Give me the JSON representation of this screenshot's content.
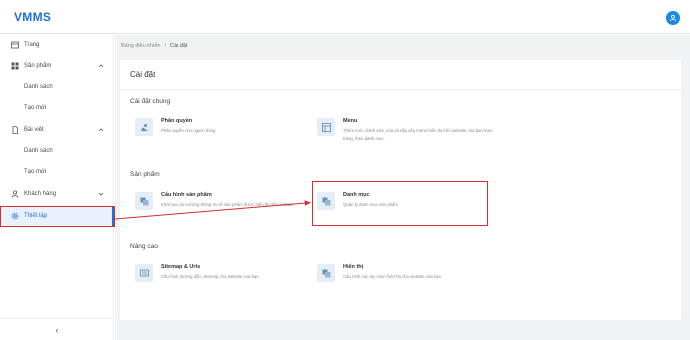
{
  "app": {
    "brand": "VMMS"
  },
  "sidebar": {
    "items": [
      {
        "label": "Trang",
        "icon": "grid-icon"
      },
      {
        "label": "Sản phẩm",
        "icon": "product-icon"
      },
      {
        "label": "Danh sách"
      },
      {
        "label": "Tạo mới"
      },
      {
        "label": "Bài viết",
        "icon": "article-icon"
      },
      {
        "label": "Danh sách"
      },
      {
        "label": "Tạo mới"
      },
      {
        "label": "Khách hàng",
        "icon": "user-icon"
      },
      {
        "label": "Thiết lập",
        "icon": "gear-icon"
      }
    ],
    "collapse_glyph": "‹"
  },
  "breadcrumb": {
    "parent": "Bảng điều khiển",
    "separator": "/",
    "current": "Cài đặt"
  },
  "page": {
    "title": "Cài đặt"
  },
  "sections": [
    {
      "title": "Cài đặt chung",
      "items": [
        {
          "name": "Phân quyền",
          "desc": "Phân quyền cho người dùng",
          "icon": "permission-icon"
        },
        {
          "name": "Menu",
          "desc": "Thêm mới, chỉnh sửa, xóa và sắp xếp menu hiển thị trên website của bạn theo trang, theo danh mục.",
          "icon": "menu-icon"
        }
      ]
    },
    {
      "title": "Sản phẩm",
      "items": [
        {
          "name": "Cấu hình sản phẩm",
          "desc": "Khởi tạo các trường thông tin về sản phẩm được hiển thị trên website",
          "icon": "product-config-icon"
        },
        {
          "name": "Danh mục",
          "desc": "Quản lý danh mục sản phẩm",
          "icon": "category-icon"
        }
      ]
    },
    {
      "title": "Nâng cao",
      "items": [
        {
          "name": "Sitemap & Urls",
          "desc": "Cấu hình đường dẫn, sitemap cho website của bạn.",
          "icon": "sitemap-icon"
        },
        {
          "name": "Hiển thị",
          "desc": "Cấu hình các tùy chọn hiển thị cho website của bạn",
          "icon": "display-icon"
        }
      ]
    }
  ],
  "colors": {
    "brand": "#1f6fd6",
    "highlight": "#d32f2f",
    "tile": "#e5edf6",
    "content_bg": "#f1f2f4"
  }
}
